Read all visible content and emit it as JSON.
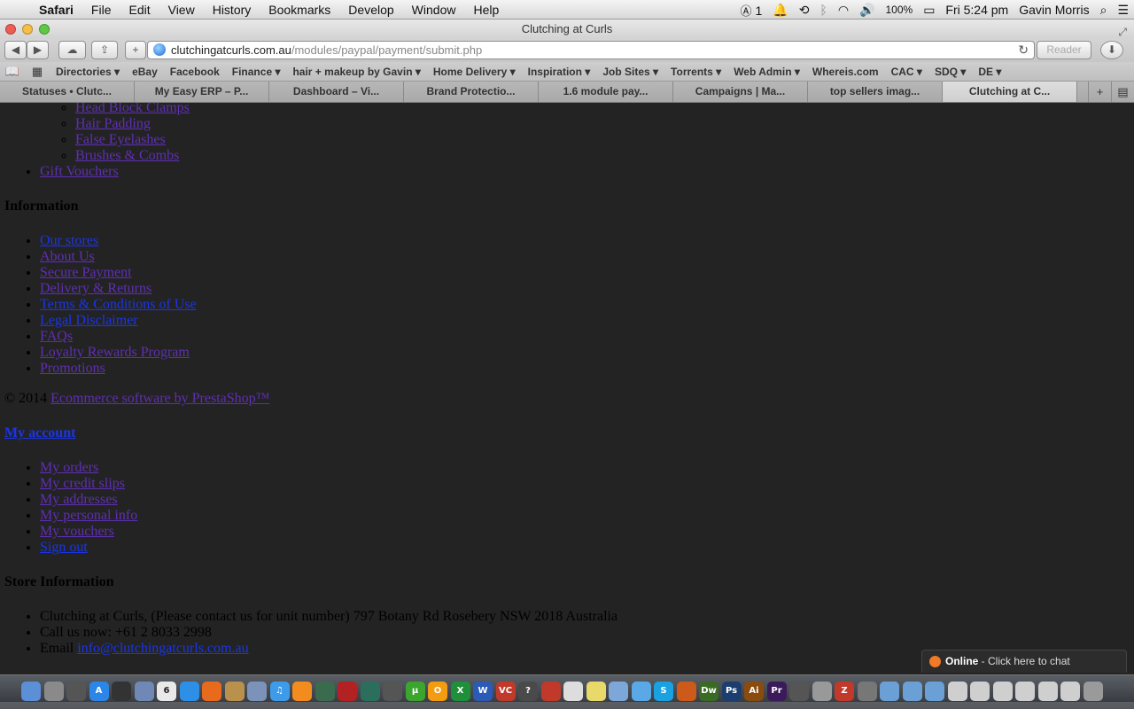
{
  "menubar": {
    "app": "Safari",
    "items": [
      "File",
      "Edit",
      "View",
      "History",
      "Bookmarks",
      "Develop",
      "Window",
      "Help"
    ],
    "adobe_count": "1",
    "battery": "100%",
    "clock": "Fri 5:24 pm",
    "user": "Gavin Morris"
  },
  "window": {
    "title": "Clutching at Curls"
  },
  "toolbar": {
    "url_host": "clutchingatcurls.com.au",
    "url_path": "/modules/paypal/payment/submit.php",
    "reader_label": "Reader"
  },
  "bookmarks": [
    "Directories ▾",
    "eBay",
    "Facebook",
    "Finance ▾",
    "hair + makeup by Gavin ▾",
    "Home Delivery ▾",
    "Inspiration ▾",
    "Job Sites ▾",
    "Torrents ▾",
    "Web Admin ▾",
    "Whereis.com",
    "CAC ▾",
    "SDQ ▾",
    "DE ▾"
  ],
  "tabs": [
    "Statuses • Clutc...",
    "My Easy ERP – P...",
    "Dashboard – Vi...",
    "Brand Protectio...",
    "1.6 module pay...",
    "Campaigns | Ma...",
    "top sellers imag...",
    "Clutching at C..."
  ],
  "page": {
    "subcategories": [
      "Head Block Clamps",
      "Hair Padding",
      "False Eyelashes",
      "Brushes & Combs"
    ],
    "gift_vouchers": "Gift Vouchers",
    "information_heading": "Information",
    "information_links": [
      "Our stores",
      "About Us",
      "Secure Payment",
      "Delivery & Returns",
      "Terms & Conditions of Use",
      "Legal Disclaimer",
      "FAQs",
      "Loyalty Rewards Program",
      "Promotions"
    ],
    "copyright": "© 2014",
    "copyright_link": "Ecommerce software by PrestaShop™",
    "account_heading": "My account",
    "account_links": [
      "My orders",
      "My credit slips",
      "My addresses",
      "My personal info",
      "My vouchers",
      "Sign out"
    ],
    "store_heading": "Store Information",
    "store_address": "Clutching at Curls, (Please contact us for unit number) 797 Botany Rd Rosebery NSW 2018 Australia",
    "store_phone": "Call us now: +61 2 8033 2998",
    "store_email_label": "Email",
    "store_email": "info@clutchingatcurls.com.au"
  },
  "chat": {
    "status": "Online",
    "text": " - Click here to chat"
  },
  "dock": {
    "apps": [
      {
        "name": "finder",
        "label": "",
        "color": "#5b8fd6"
      },
      {
        "name": "launchpad",
        "label": "",
        "color": "#8a8a8a"
      },
      {
        "name": "mission-control",
        "label": "",
        "color": "#555"
      },
      {
        "name": "app-store",
        "label": "A",
        "color": "#2b86e8"
      },
      {
        "name": "dashboard",
        "label": "",
        "color": "#333"
      },
      {
        "name": "preview",
        "label": "",
        "color": "#6f88b5"
      },
      {
        "name": "calendar",
        "label": "6",
        "color": "#e9e9e9"
      },
      {
        "name": "safari",
        "label": "",
        "color": "#2d8fe6"
      },
      {
        "name": "firefox",
        "label": "",
        "color": "#e86a1d"
      },
      {
        "name": "address-book",
        "label": "",
        "color": "#b9914c"
      },
      {
        "name": "preview-2",
        "label": "",
        "color": "#7b93b8"
      },
      {
        "name": "itunes",
        "label": "♫",
        "color": "#3d9be9"
      },
      {
        "name": "ibooks",
        "label": "",
        "color": "#f28c1f"
      },
      {
        "name": "photo",
        "label": "",
        "color": "#3a6b4f"
      },
      {
        "name": "photo-booth",
        "label": "",
        "color": "#b22222"
      },
      {
        "name": "time-machine",
        "label": "",
        "color": "#2c6e5c"
      },
      {
        "name": "utility",
        "label": "",
        "color": "#555"
      },
      {
        "name": "utorrent",
        "label": "μ",
        "color": "#3ba52e"
      },
      {
        "name": "vlc",
        "label": "O",
        "color": "#f39c12"
      },
      {
        "name": "excel",
        "label": "X",
        "color": "#1f8f3a"
      },
      {
        "name": "word",
        "label": "W",
        "color": "#2b5ab7"
      },
      {
        "name": "vc",
        "label": "VC",
        "color": "#c0392b"
      },
      {
        "name": "help",
        "label": "?",
        "color": "#4a4a4a"
      },
      {
        "name": "activity",
        "label": "",
        "color": "#c0392b"
      },
      {
        "name": "textedit",
        "label": "",
        "color": "#ddd"
      },
      {
        "name": "stickies",
        "label": "",
        "color": "#e9d96b"
      },
      {
        "name": "grapher",
        "label": "",
        "color": "#7da7d9"
      },
      {
        "name": "messages",
        "label": "",
        "color": "#5aa9e6"
      },
      {
        "name": "skype",
        "label": "S",
        "color": "#1aa1e1"
      },
      {
        "name": "growl",
        "label": "",
        "color": "#cc5a1b"
      },
      {
        "name": "dreamweaver",
        "label": "Dw",
        "color": "#3a6b24"
      },
      {
        "name": "photoshop",
        "label": "Ps",
        "color": "#1c3e6e"
      },
      {
        "name": "illustrator",
        "label": "Ai",
        "color": "#8a4b0e"
      },
      {
        "name": "premiere",
        "label": "Pr",
        "color": "#3b1a5a"
      },
      {
        "name": "automator",
        "label": "",
        "color": "#555"
      },
      {
        "name": "script",
        "label": "",
        "color": "#999"
      },
      {
        "name": "filezilla",
        "label": "Z",
        "color": "#c0392b"
      },
      {
        "name": "system-prefs",
        "label": "",
        "color": "#777"
      },
      {
        "name": "folder-1",
        "label": "",
        "color": "#6aa0d6"
      },
      {
        "name": "folder-2",
        "label": "",
        "color": "#6aa0d6"
      },
      {
        "name": "folder-3",
        "label": "",
        "color": "#6aa0d6"
      },
      {
        "name": "doc-1",
        "label": "",
        "color": "#cfcfcf"
      },
      {
        "name": "doc-2",
        "label": "",
        "color": "#cfcfcf"
      },
      {
        "name": "doc-3",
        "label": "",
        "color": "#cfcfcf"
      },
      {
        "name": "doc-4",
        "label": "",
        "color": "#cfcfcf"
      },
      {
        "name": "doc-5",
        "label": "",
        "color": "#cfcfcf"
      },
      {
        "name": "doc-6",
        "label": "",
        "color": "#cfcfcf"
      },
      {
        "name": "trash",
        "label": "",
        "color": "#9a9a9a"
      }
    ]
  }
}
